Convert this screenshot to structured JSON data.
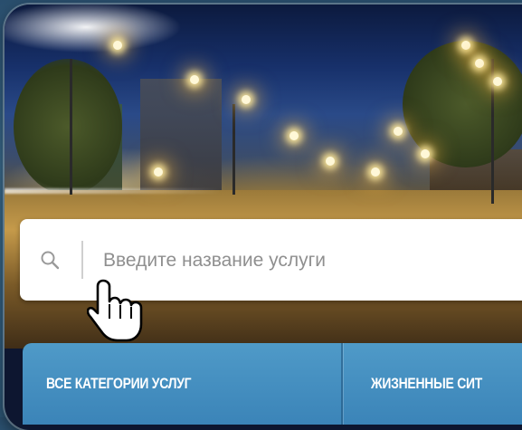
{
  "search": {
    "placeholder": "Введите название услуги",
    "icon": "search-icon"
  },
  "tabs": [
    {
      "label": "ВСЕ КАТЕГОРИИ УСЛУГ"
    },
    {
      "label": "ЖИЗНЕННЫЕ СИТ"
    }
  ],
  "colors": {
    "tab_bar": "#3b84b8",
    "search_bg": "#ffffff",
    "placeholder": "#8f8f8f"
  }
}
